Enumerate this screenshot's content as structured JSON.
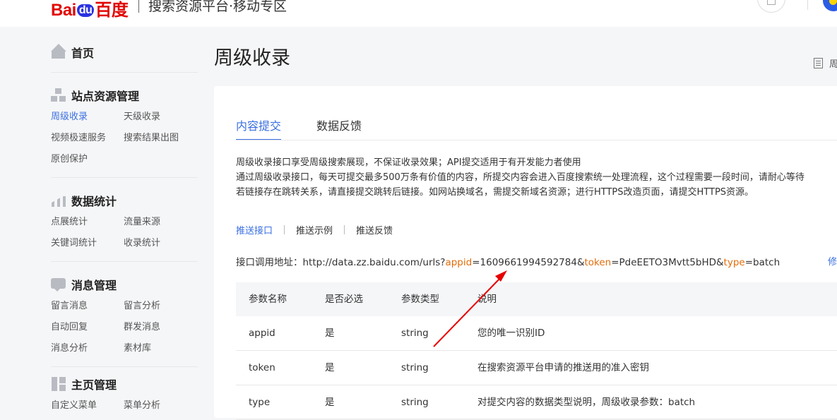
{
  "header": {
    "logo_text": "Bai",
    "logo_paw": "du",
    "logo_cn": "百度",
    "title": "搜索资源平台·移动专区"
  },
  "sidebar": {
    "groups": [
      {
        "title": "首页",
        "icon": "home-icon",
        "items": []
      },
      {
        "title": "站点资源管理",
        "icon": "site-icon",
        "items": [
          "周级收录",
          "天级收录",
          "视频极速服务",
          "搜索结果出图",
          "原创保护"
        ]
      },
      {
        "title": "数据统计",
        "icon": "chart-icon",
        "items": [
          "点展统计",
          "流量来源",
          "关键词统计",
          "收录统计"
        ]
      },
      {
        "title": "消息管理",
        "icon": "message-icon",
        "items": [
          "留言消息",
          "留言分析",
          "自动回复",
          "群发消息",
          "消息分析",
          "素材库"
        ]
      },
      {
        "title": "主页管理",
        "icon": "page-icon",
        "items": [
          "自定义菜单",
          "菜单分析"
        ]
      }
    ]
  },
  "main": {
    "page_title": "周级收录",
    "right_link": "周",
    "tabs": [
      "内容提交",
      "数据反馈"
    ],
    "desc": [
      "周级收录接口享受周级搜索展现，不保证收录效果；API提交适用于有开发能力者使用",
      "通过周级收录接口，每天可提交最多500万条有价值的内容，所提交内容会进入百度搜索统一处理流程，这个过程需要一段时间，请耐心等待",
      "若链接存在跳转关系，请直接提交跳转后链接。如网站换域名，需提交新域名资源；进行HTTPS改造页面，请提交HTTPS资源。"
    ],
    "subtabs": [
      "推送接口",
      "推送示例",
      "推送反馈"
    ],
    "api": {
      "label": "接口调用地址：",
      "base": "http://data.zz.baidu.com/urls?",
      "k1": "appid",
      "v1": "=1609661994592784&",
      "k2": "token",
      "v2": "=PdeEETO3Mvtt5bHD&",
      "k3": "type",
      "v3": "=batch",
      "edit": "修"
    },
    "table": {
      "headers": [
        "参数名称",
        "是否必选",
        "参数类型",
        "说明"
      ],
      "rows": [
        [
          "appid",
          "是",
          "string",
          "您的唯一识别ID"
        ],
        [
          "token",
          "是",
          "string",
          "在搜索资源平台申请的推送用的准入密钥"
        ],
        [
          "type",
          "是",
          "string",
          "对提交内容的数据类型说明，周级收录参数：batch"
        ]
      ]
    }
  },
  "colors": {
    "accent": "#3a6fe0",
    "highlight": "#e36c0a",
    "arrow": "#e60000"
  }
}
